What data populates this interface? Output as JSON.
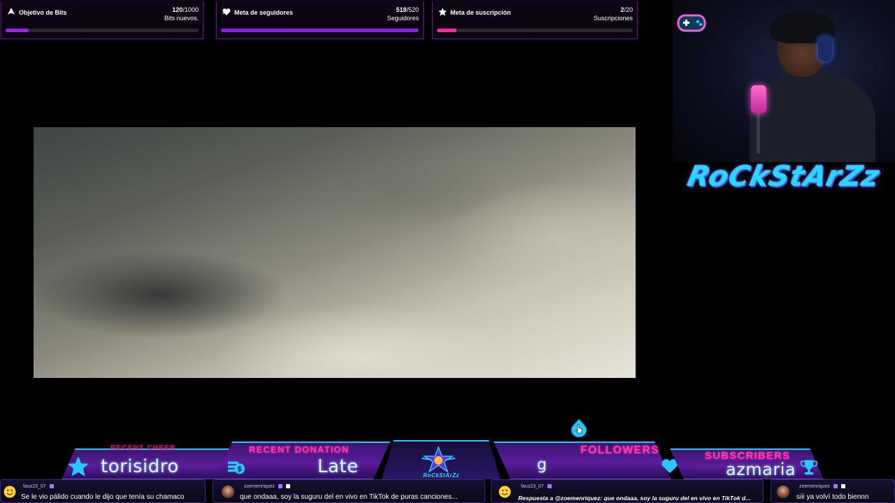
{
  "goals": [
    {
      "title": "Objetivo de Bits",
      "current": "120",
      "target": "1000",
      "unit": "Bits nuevos.",
      "icon": "bits-icon",
      "progress": 0.12,
      "color": "#a020f0"
    },
    {
      "title": "Meta de seguidores",
      "current": "518",
      "target": "520",
      "unit": "Seguidores",
      "icon": "heart-icon",
      "progress": 0.996,
      "color": "#8a1cf0"
    },
    {
      "title": "Meta de suscripción",
      "current": "2",
      "target": "20",
      "unit": "Suscripciones",
      "icon": "star-icon",
      "progress": 0.1,
      "color": "#ff2aa0"
    }
  ],
  "goal_separator": "/",
  "brand": {
    "name": "RoCkStArZz"
  },
  "banner": {
    "recent_cheer": {
      "label": "RECENT CHEER",
      "value": "torisidro",
      "icon": "star-icon"
    },
    "recent_donation": {
      "label": "RECENT DONATION",
      "value": "Late",
      "icon": "money-icon"
    },
    "center_logo": "RoCkStArZz",
    "followers": {
      "label": "FOLLOWERS",
      "value": "g",
      "icon": "heart-icon"
    },
    "subscribers": {
      "label": "SUBSCRIBERS",
      "value": "azmaria",
      "icon": "trophy-icon"
    }
  },
  "chat": [
    {
      "user": "faus23_07",
      "text": "Se le vio pálido cuando le dijo que tenía su chamaco",
      "avatar": "smiley-avatar",
      "reply": false
    },
    {
      "user": "zoemenriquez",
      "text": "que ondaaa, soy la suguru del en vivo en TikTok de puras canciones...",
      "avatar": "photo-avatar",
      "reply": false
    },
    {
      "user": "faus23_07",
      "text": "Respuesta a @zoemenriquez: que ondaaa, soy la suguru del en vivo en TikTok d...",
      "avatar": "smiley-avatar",
      "reply": true
    },
    {
      "user": "zoemenriquez",
      "text": "siii ya volví todo biennn",
      "avatar": "photo-avatar",
      "reply": false
    }
  ],
  "colors": {
    "accent_pink": "#ff38b6",
    "accent_cyan": "#28c8ff",
    "panel_purple": "#5a1c9a"
  }
}
